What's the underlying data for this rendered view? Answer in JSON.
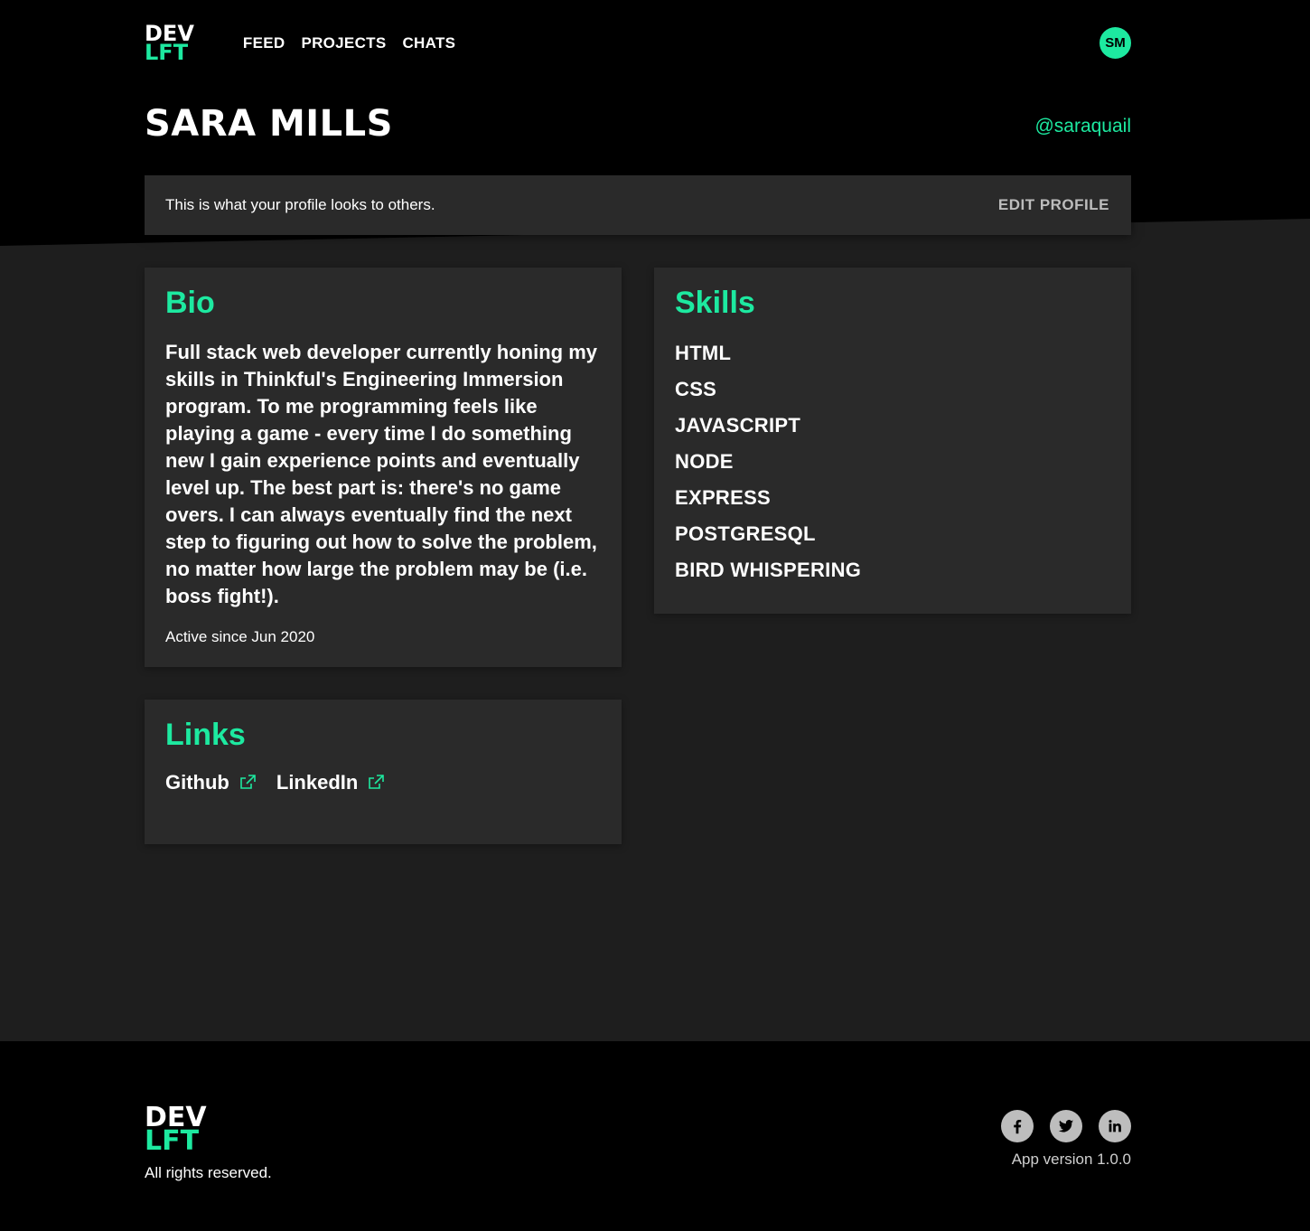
{
  "brand": {
    "logo_line1": "DEV",
    "logo_line2": "LFT",
    "accent": "#1de9a0"
  },
  "nav": {
    "items": [
      {
        "label": "FEED"
      },
      {
        "label": "PROJECTS"
      },
      {
        "label": "CHATS"
      }
    ]
  },
  "user": {
    "initials": "SM",
    "name": "SARA MILLS",
    "handle": "@saraquail"
  },
  "notice": {
    "message": "This is what your profile looks to others.",
    "edit_label": "EDIT PROFILE"
  },
  "bio": {
    "heading": "Bio",
    "text": "Full stack web developer currently honing my skills in Thinkful's Engineering Immersion program. To me programming feels like playing a game - every time I do something new I gain experience points and eventually level up. The best part is: there's no game overs. I can always eventually find the next step to figuring out how to solve the problem, no matter how large the problem may be (i.e. boss fight!).",
    "active_since": "Active since Jun 2020"
  },
  "links": {
    "heading": "Links",
    "items": [
      {
        "label": "Github",
        "icon": "external-link-icon"
      },
      {
        "label": "LinkedIn",
        "icon": "external-link-icon"
      }
    ]
  },
  "skills": {
    "heading": "Skills",
    "items": [
      "HTML",
      "CSS",
      "JAVASCRIPT",
      "NODE",
      "EXPRESS",
      "POSTGRESQL",
      "BIRD WHISPERING"
    ]
  },
  "footer": {
    "rights": "All rights reserved.",
    "version": "App version 1.0.0",
    "social": [
      "facebook-icon",
      "twitter-icon",
      "linkedin-icon"
    ]
  }
}
